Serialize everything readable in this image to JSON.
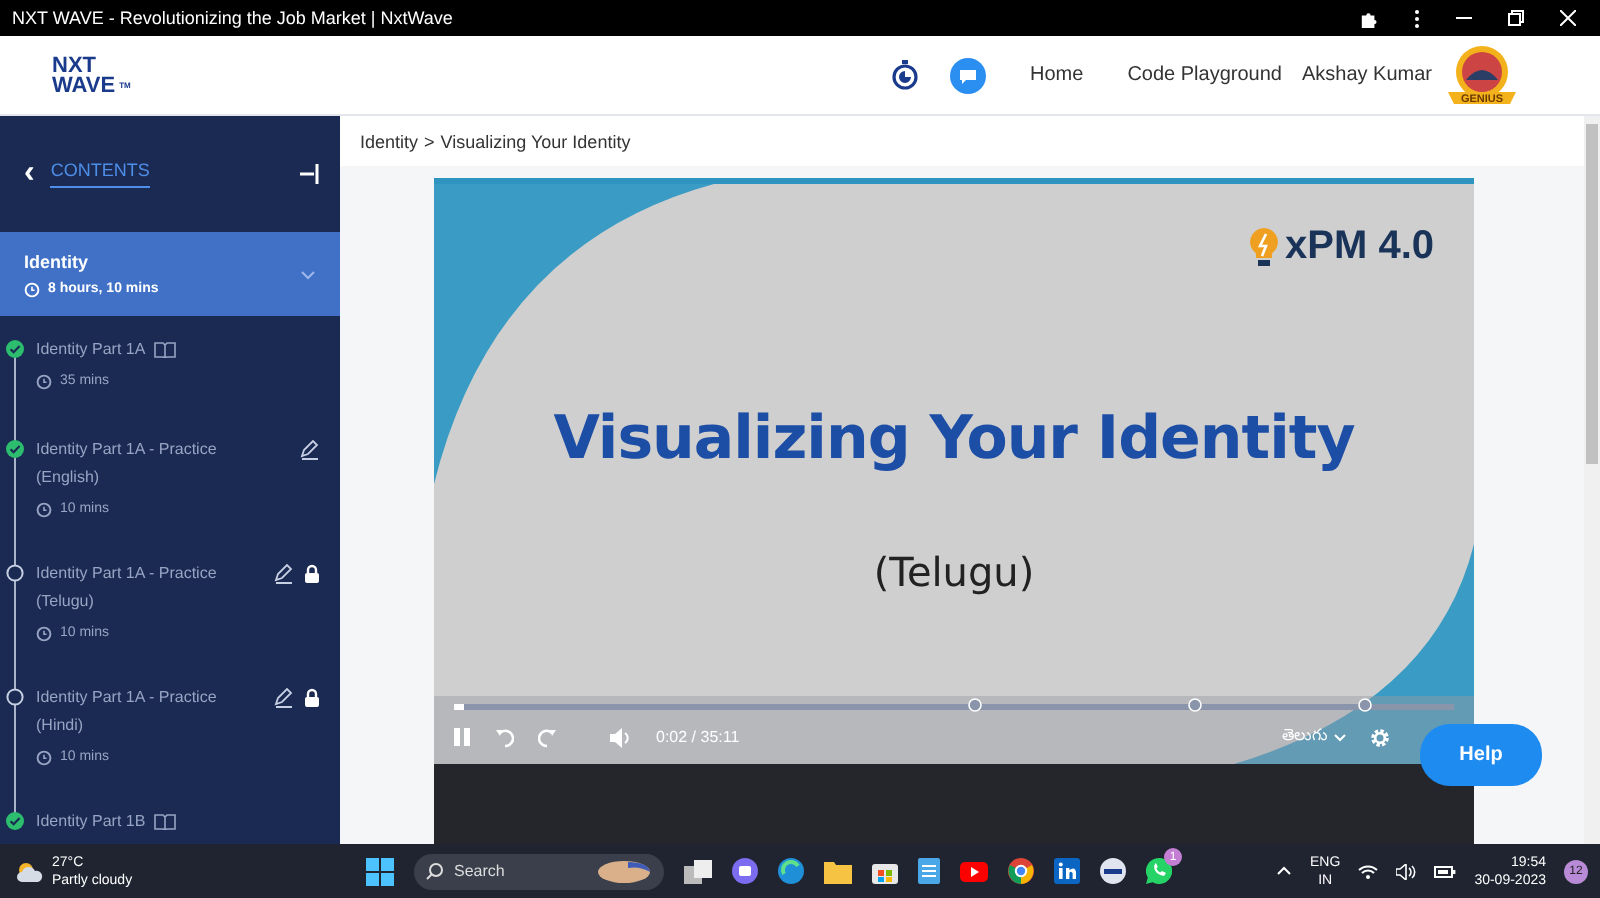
{
  "window": {
    "title": "NXT WAVE - Revolutionizing the Job Market | NxtWave"
  },
  "header": {
    "logo_top": "NXT",
    "logo_bottom": "WAVE",
    "logo_mark": "TM",
    "nav": [
      "Home",
      "Code Playground"
    ],
    "user": "Akshay Kumar",
    "badge": "GENIUS"
  },
  "sidebar": {
    "back": "‹",
    "heading": "CONTENTS",
    "module": {
      "title": "Identity",
      "duration": "8 hours, 10 mins",
      "expanded": true
    },
    "items": [
      {
        "title": "Identity Part 1A",
        "duration": "35 mins",
        "kind": "reading",
        "completed": true,
        "locked": false
      },
      {
        "title": "Identity Part 1A - Practice (English)",
        "duration": "10 mins",
        "kind": "practice",
        "completed": true,
        "locked": false
      },
      {
        "title": "Identity Part 1A - Practice (Telugu)",
        "duration": "10 mins",
        "kind": "practice",
        "completed": false,
        "locked": true
      },
      {
        "title": "Identity Part 1A - Practice (Hindi)",
        "duration": "10 mins",
        "kind": "practice",
        "completed": false,
        "locked": true
      },
      {
        "title": "Identity Part 1B",
        "kind": "reading",
        "completed": true,
        "locked": false
      }
    ]
  },
  "breadcrumb": {
    "parts": [
      "Identity",
      "Visualizing Your Identity"
    ],
    "separator": ">"
  },
  "video": {
    "brand": "xPM 4.0",
    "title": "Visualizing Your Identity",
    "subtitle": "(Telugu)",
    "playing": true,
    "progress": {
      "level": 0.01
    },
    "time": "0:02 / 35:11",
    "language": "తెలుగు"
  },
  "help": "Help",
  "taskbar": {
    "temperature": "27°C",
    "weather": "Partly cloudy",
    "search": "Search",
    "whatsapp_badge": "1",
    "lang_top": "ENG",
    "lang_bottom": "IN",
    "time": "19:54",
    "date": "30-09-2023",
    "notifications": "12"
  }
}
